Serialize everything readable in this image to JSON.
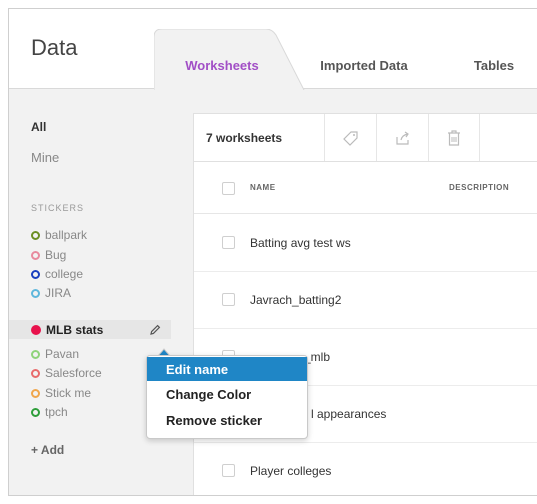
{
  "app": {
    "title": "Data"
  },
  "tabs": [
    {
      "label": "Worksheets",
      "active": true
    },
    {
      "label": "Imported Data",
      "active": false
    },
    {
      "label": "Tables",
      "active": false
    }
  ],
  "sidebar": {
    "all_label": "All",
    "mine_label": "Mine",
    "stickers_heading": "STICKERS",
    "stickers": [
      {
        "label": "ballpark",
        "color": "#6b8e23",
        "style": "ring"
      },
      {
        "label": "Bug",
        "color": "#e88a9e",
        "style": "ring"
      },
      {
        "label": "college",
        "color": "#1a3fbf",
        "style": "ring"
      },
      {
        "label": "JIRA",
        "color": "#5fb7dc",
        "style": "ring"
      },
      {
        "label": "MLB stats",
        "color": "#e8124c",
        "style": "dot",
        "selected": true
      },
      {
        "label": "Pavan",
        "color": "#8fd37a",
        "style": "ring"
      },
      {
        "label": "Salesforce",
        "color": "#e86b6b",
        "style": "ring"
      },
      {
        "label": "Stick me",
        "color": "#f0a64c",
        "style": "ring"
      },
      {
        "label": "tpch",
        "color": "#2e9e3a",
        "style": "ring"
      }
    ],
    "add_label": "+ Add"
  },
  "main": {
    "count_label": "7 worksheets",
    "toolbar_icons": [
      "tag-icon",
      "share-icon",
      "trash-icon"
    ],
    "columns": {
      "name": "NAME",
      "description": "DESCRIPTION"
    },
    "rows": [
      {
        "name": "Batting avg test ws"
      },
      {
        "name": "Javrach_batting2"
      },
      {
        "name": "_mlb"
      },
      {
        "name": "l appearances"
      },
      {
        "name": "Player colleges"
      }
    ]
  },
  "context_menu": {
    "items": [
      {
        "label": "Edit name",
        "highlighted": true
      },
      {
        "label": "Change Color",
        "highlighted": false
      },
      {
        "label": "Remove sticker",
        "highlighted": false
      }
    ]
  },
  "colors": {
    "accent": "#a24fc6",
    "highlight": "#1f86c6"
  }
}
